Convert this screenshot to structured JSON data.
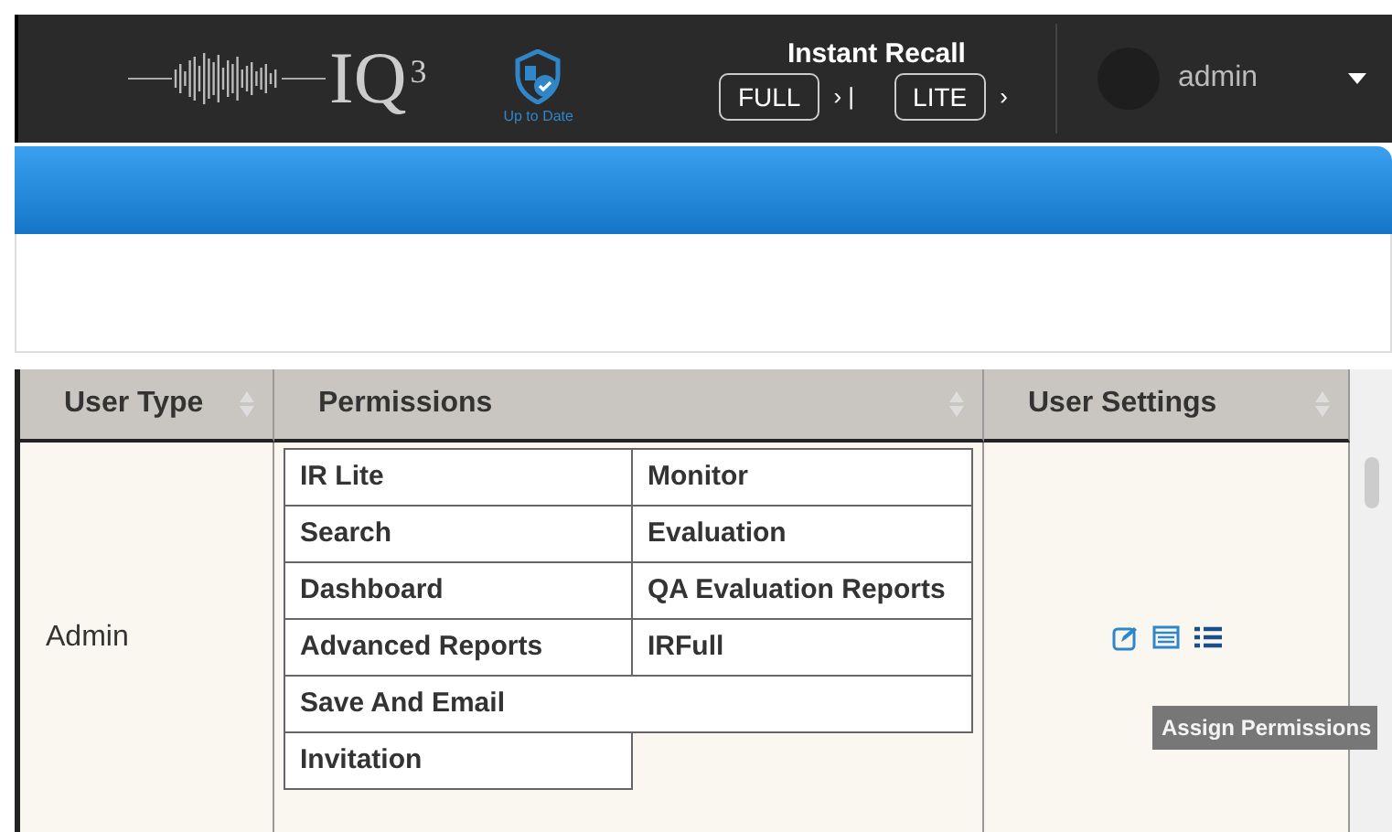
{
  "header": {
    "logo_text": "IQ",
    "logo_sup": "3",
    "status": "Up to Date",
    "recall_title": "Instant Recall",
    "recall_buttons": [
      {
        "label": "FULL",
        "after": "› |"
      },
      {
        "label": "LITE",
        "after": "›"
      }
    ],
    "user": "admin"
  },
  "table": {
    "columns": [
      {
        "label": "User Type",
        "sortable": true
      },
      {
        "label": "Permissions",
        "sortable": true
      },
      {
        "label": "User Settings",
        "sortable": true
      }
    ],
    "rows": [
      {
        "user_type": "Admin",
        "permissions": [
          {
            "kind": "pair",
            "cells": [
              "IR Lite",
              "Monitor"
            ]
          },
          {
            "kind": "pair",
            "cells": [
              "Search",
              "Evaluation"
            ]
          },
          {
            "kind": "pair",
            "cells": [
              "Dashboard",
              "QA Evaluation Reports"
            ]
          },
          {
            "kind": "pair",
            "cells": [
              "Advanced Reports",
              "IRFull"
            ]
          },
          {
            "kind": "wide",
            "cells": [
              "Save And Email"
            ]
          },
          {
            "kind": "half",
            "cells": [
              "Invitation"
            ]
          }
        ]
      }
    ]
  },
  "tooltip": "Assign Permissions"
}
